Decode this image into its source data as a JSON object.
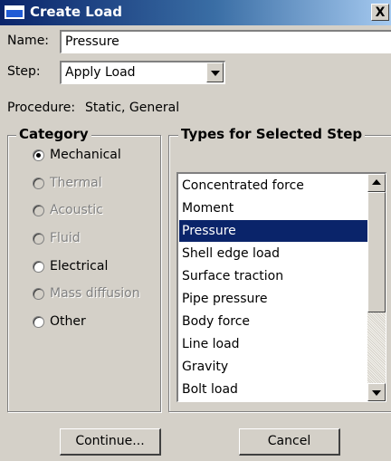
{
  "window": {
    "title": "Create Load",
    "close_glyph": "X"
  },
  "form": {
    "name_label": "Name:",
    "name_value": "Pressure",
    "step_label": "Step:",
    "step_value": "Apply Load",
    "procedure_label": "Procedure:",
    "procedure_value": "Static, General"
  },
  "category": {
    "title": "Category",
    "options": [
      {
        "label": "Mechanical",
        "checked": true,
        "enabled": true
      },
      {
        "label": "Thermal",
        "checked": false,
        "enabled": false
      },
      {
        "label": "Acoustic",
        "checked": false,
        "enabled": false
      },
      {
        "label": "Fluid",
        "checked": false,
        "enabled": false
      },
      {
        "label": "Electrical",
        "checked": false,
        "enabled": true
      },
      {
        "label": "Mass diffusion",
        "checked": false,
        "enabled": false
      },
      {
        "label": "Other",
        "checked": false,
        "enabled": true
      }
    ]
  },
  "types": {
    "title": "Types for Selected Step",
    "selected_index": 2,
    "items": [
      "Concentrated force",
      "Moment",
      "Pressure",
      "Shell edge load",
      "Surface traction",
      "Pipe pressure",
      "Body force",
      "Line load",
      "Gravity",
      "Bolt load"
    ]
  },
  "buttons": {
    "continue": "Continue...",
    "cancel": "Cancel"
  },
  "icons": {
    "app": "window-icon",
    "close": "close-icon",
    "dropdown": "chevron-down-icon",
    "scroll_up": "arrow-up-icon",
    "scroll_down": "arrow-down-icon"
  },
  "colors": {
    "selection": "#0a246a",
    "title_bar_start": "#0a246a",
    "face": "#d4d0c8"
  }
}
